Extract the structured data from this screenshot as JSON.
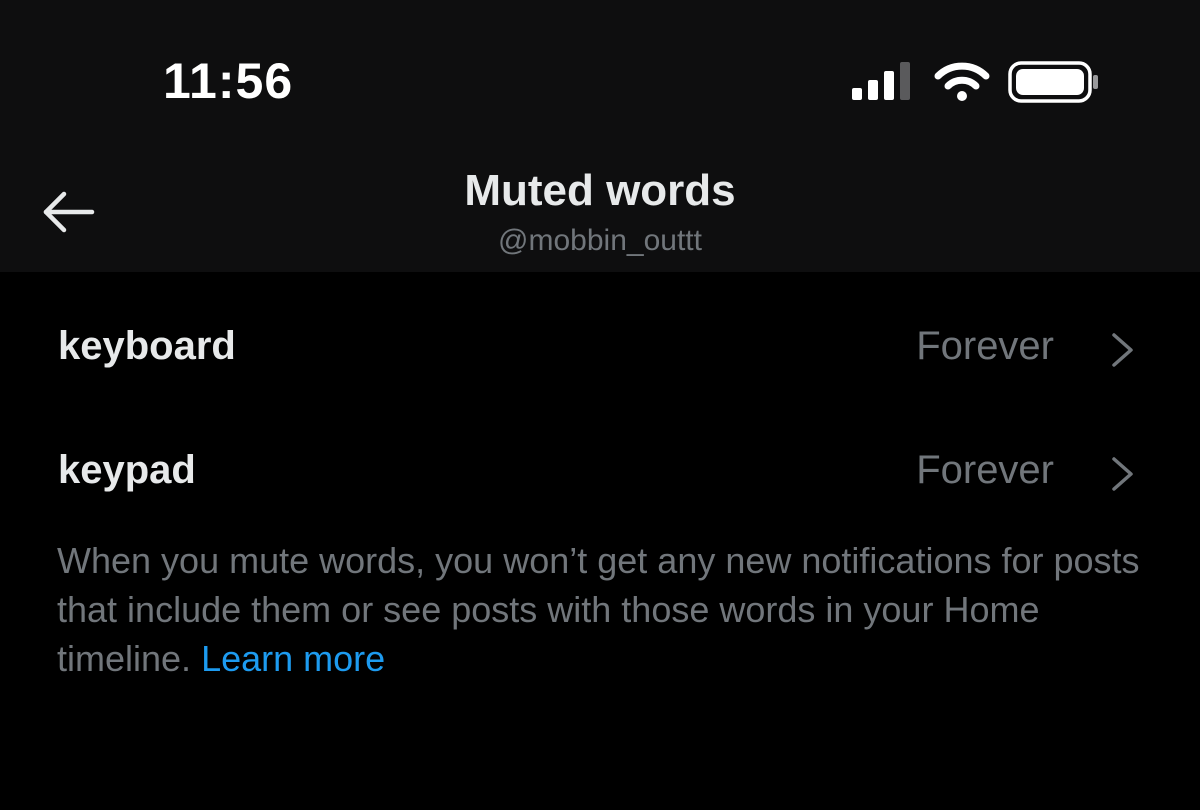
{
  "status_bar": {
    "time": "11:56",
    "icons": [
      "signal-icon",
      "wifi-icon",
      "battery-icon"
    ]
  },
  "nav": {
    "title": "Muted words",
    "subtitle": "@mobbin_outtt",
    "back_icon": "back-arrow-icon"
  },
  "muted_words": [
    {
      "word": "keyboard",
      "duration": "Forever"
    },
    {
      "word": "keypad",
      "duration": "Forever"
    }
  ],
  "info": {
    "text": "When you mute words, you won’t get any new notifications for posts that include them or see posts with those words in your Home timeline.",
    "link_label": "Learn more"
  },
  "colors": {
    "background": "#000000",
    "header_background": "#0e0e0f",
    "primary_text": "#e7e9ea",
    "secondary_text": "#71767b",
    "accent": "#1d9bf0"
  }
}
